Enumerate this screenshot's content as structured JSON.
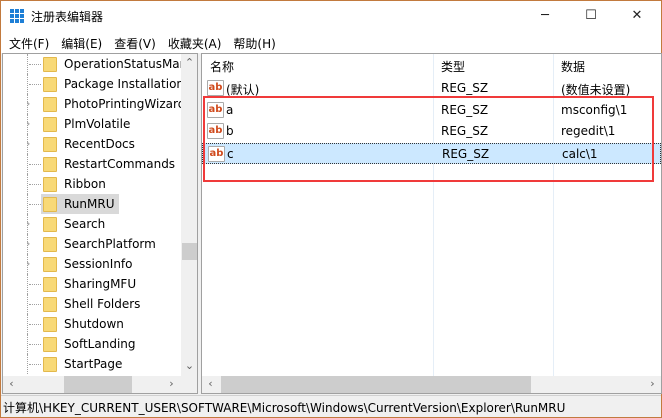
{
  "window": {
    "title": "注册表编辑器",
    "minimize": "─",
    "maximize": "☐",
    "close": "✕"
  },
  "menu": [
    "文件(F)",
    "编辑(E)",
    "查看(V)",
    "收藏夹(A)",
    "帮助(H)"
  ],
  "tree": [
    {
      "label": "OperationStatusManager",
      "expand": false
    },
    {
      "label": "Package Installation",
      "expand": false
    },
    {
      "label": "PhotoPrintingWizard",
      "expand": true
    },
    {
      "label": "PlmVolatile",
      "expand": true
    },
    {
      "label": "RecentDocs",
      "expand": true
    },
    {
      "label": "RestartCommands",
      "expand": false
    },
    {
      "label": "Ribbon",
      "expand": false
    },
    {
      "label": "RunMRU",
      "expand": false,
      "selected": true
    },
    {
      "label": "Search",
      "expand": true
    },
    {
      "label": "SearchPlatform",
      "expand": true
    },
    {
      "label": "SessionInfo",
      "expand": true
    },
    {
      "label": "SharingMFU",
      "expand": false
    },
    {
      "label": "Shell Folders",
      "expand": false
    },
    {
      "label": "Shutdown",
      "expand": false
    },
    {
      "label": "SoftLanding",
      "expand": false
    },
    {
      "label": "StartPage",
      "expand": false
    }
  ],
  "values": {
    "headers": {
      "name": "名称",
      "type": "类型",
      "data": "数据"
    },
    "icon_text": "ab",
    "rows": [
      {
        "name": "(默认)",
        "type": "REG_SZ",
        "data": "(数值未设置)"
      },
      {
        "name": "a",
        "type": "REG_SZ",
        "data": "msconfig\\1"
      },
      {
        "name": "b",
        "type": "REG_SZ",
        "data": "regedit\\1"
      },
      {
        "name": "c",
        "type": "REG_SZ",
        "data": "calc\\1",
        "selected": true
      }
    ]
  },
  "status": "计算机\\HKEY_CURRENT_USER\\SOFTWARE\\Microsoft\\Windows\\CurrentVersion\\Explorer\\RunMRU",
  "colors": {
    "highlight_box": "#f03a3a",
    "selection": "#cce8ff"
  }
}
